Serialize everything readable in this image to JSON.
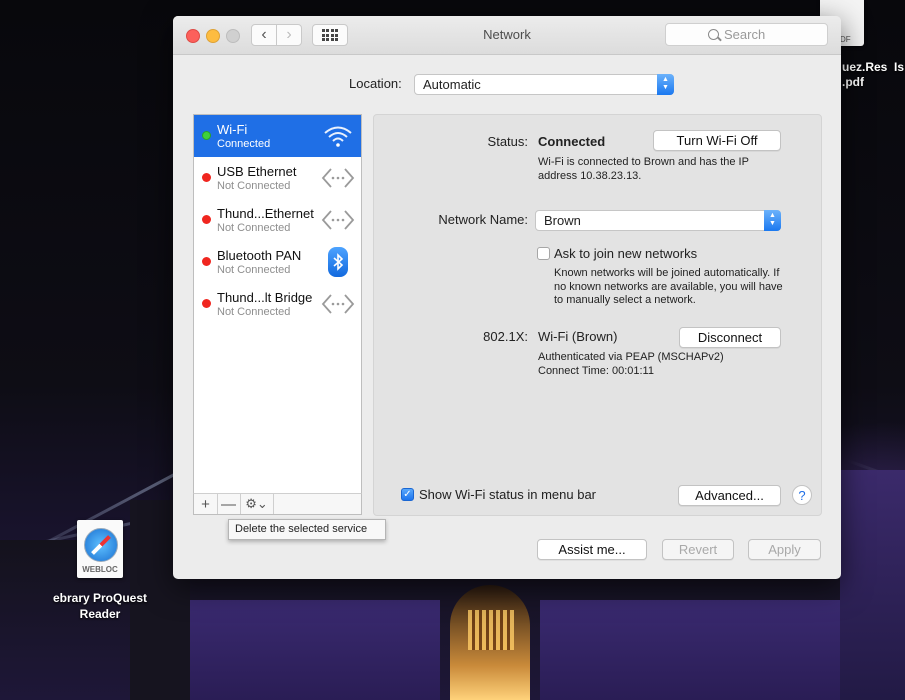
{
  "window": {
    "title": "Network"
  },
  "search": {
    "placeholder": "Search"
  },
  "location": {
    "label": "Location:",
    "value": "Automatic"
  },
  "services": [
    {
      "name": "Wi-Fi",
      "status": "Connected",
      "state": "connected",
      "icon": "wifi-icon",
      "selected": true
    },
    {
      "name": "USB Ethernet",
      "status": "Not Connected",
      "state": "disconnected",
      "icon": "ethernet-icon",
      "selected": false
    },
    {
      "name": "Thund...Ethernet",
      "status": "Not Connected",
      "state": "disconnected",
      "icon": "ethernet-icon",
      "selected": false
    },
    {
      "name": "Bluetooth PAN",
      "status": "Not Connected",
      "state": "disconnected",
      "icon": "bluetooth-icon",
      "selected": false
    },
    {
      "name": "Thund...lt Bridge",
      "status": "Not Connected",
      "state": "disconnected",
      "icon": "ethernet-icon",
      "selected": false
    }
  ],
  "list_toolbar": {
    "add": "+",
    "remove": "—",
    "gear": "⚙⌄"
  },
  "tooltip": "Delete the selected service",
  "details": {
    "status_label": "Status:",
    "status_value": "Connected",
    "status_description_1": "Wi-Fi is connected to Brown and has the IP",
    "status_description_2": "address 10.38.23.13.",
    "turn_off_button": "Turn Wi-Fi Off",
    "network_name_label": "Network Name:",
    "network_name_value": "Brown",
    "ask_join_label": "Ask to join new networks",
    "ask_join_checked": false,
    "ask_join_help_1": "Known networks will be joined automatically. If",
    "ask_join_help_2": "no known networks are available, you will have",
    "ask_join_help_3": "to manually select a network.",
    "dot1x_label": "802.1X:",
    "dot1x_value": "Wi-Fi (Brown)",
    "disconnect_button": "Disconnect",
    "auth_text": "Authenticated via PEAP (MSCHAPv2)",
    "connect_time": "Connect Time: 00:01:11",
    "show_status_label": "Show Wi-Fi status in menu bar",
    "show_status_checked": true,
    "advanced_button": "Advanced...",
    "help": "?"
  },
  "footer": {
    "assist_button": "Assist me...",
    "revert_button": "Revert",
    "apply_button": "Apply"
  },
  "desktop": {
    "pdf_label_1": "uez.Res",
    "pdf_label_suffix": "Is",
    "pdf_label_2": ".pdf",
    "pdf_tag": "DF",
    "webloc_tag": "WEBLOC",
    "webloc_label_1": "ebrary ProQuest",
    "webloc_label_2": "Reader"
  },
  "colors": {
    "selection": "#1f6fe6",
    "connected": "#3fd13a",
    "disconnected": "#f0261f"
  }
}
